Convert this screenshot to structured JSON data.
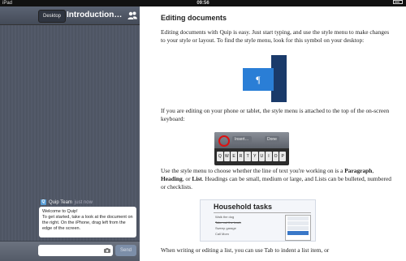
{
  "status_bar": {
    "carrier": "iPad",
    "time": "09:56"
  },
  "sidebar": {
    "desktop_button": "Desktop",
    "title": "Introduction to …",
    "chat": {
      "sender": "Quip Team",
      "timestamp": "just now",
      "message_line1": "Welcome to Quip!",
      "message_line2": "To get started, take a look at the document on the right. On the iPhone, drag left from the edge of the screen."
    },
    "send_button": "Send"
  },
  "document": {
    "heading": "Editing documents",
    "para1": "Editing documents with Quip is easy. Just start typing, and use the style menu to make changes to your style or layout. To find the style menu, look for this symbol on your desktop:",
    "style_symbol": "¶",
    "para2": "If you are editing on your phone or tablet, the style menu is attached to the top of the on-screen keyboard:",
    "keyboard": {
      "toolbar_buttons": [
        "Insert…",
        "Done"
      ],
      "keys": [
        "Q",
        "W",
        "E",
        "R",
        "T",
        "Y",
        "U",
        "I",
        "O",
        "P"
      ]
    },
    "para3_parts": {
      "a": "Use the style menu to choose whether the line of text you're working on is a ",
      "paragraph": "Paragraph",
      "b": ", ",
      "heading": "Heading",
      "c": ", or ",
      "list": "List",
      "d": ". Headings can be small, medium or large, and Lists can be bulleted, numbered or checklists."
    },
    "household": {
      "title": "Household tasks",
      "items": [
        "Walk the dog",
        "Take out the trash",
        "Sweep garage",
        "Call Mom"
      ],
      "menu_items": [
        "Large",
        "Medium",
        "Small",
        "Bulleted",
        "Numbered",
        "Checklist"
      ]
    },
    "para4": "When writing or editing a list, you can use Tab to indent a list item, or"
  }
}
